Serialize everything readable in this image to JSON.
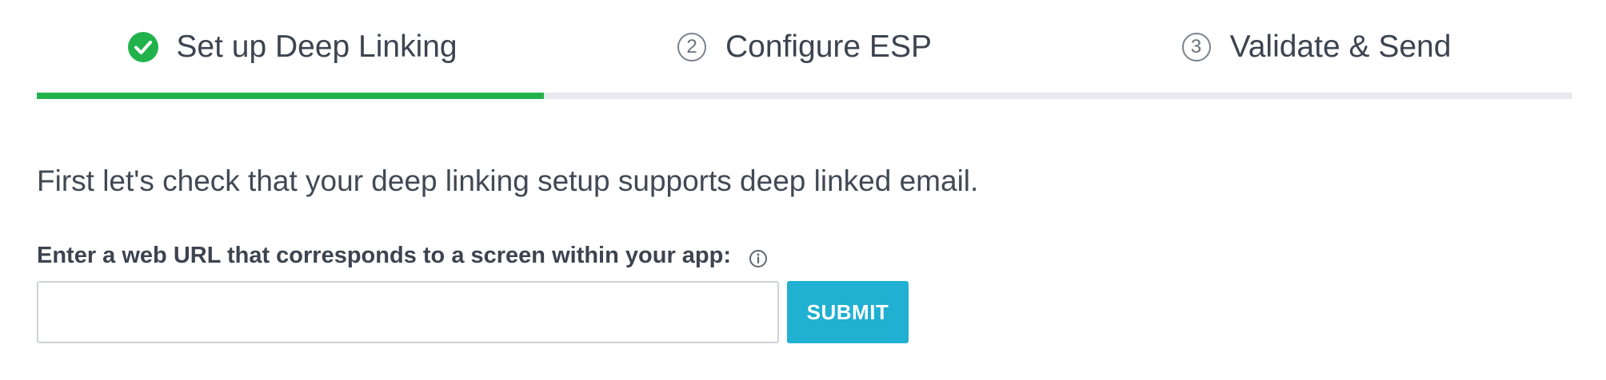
{
  "stepper": {
    "steps": [
      {
        "label": "Set up Deep Linking",
        "state": "completed",
        "icon": "check-circle-icon"
      },
      {
        "number": "2",
        "label": "Configure ESP",
        "state": "pending"
      },
      {
        "number": "3",
        "label": "Validate & Send",
        "state": "pending"
      }
    ],
    "progress": 0.33,
    "colors": {
      "completed": "#22b24c",
      "track": "#e8e9ee"
    }
  },
  "intro_text": "First let's check that your deep linking setup supports deep linked email.",
  "url_field": {
    "label": "Enter a web URL that corresponds to a screen within your app:",
    "value": "",
    "placeholder": "",
    "info_icon": "info-icon"
  },
  "submit": {
    "label": "SUBMIT",
    "color": "#1fb0d2"
  }
}
